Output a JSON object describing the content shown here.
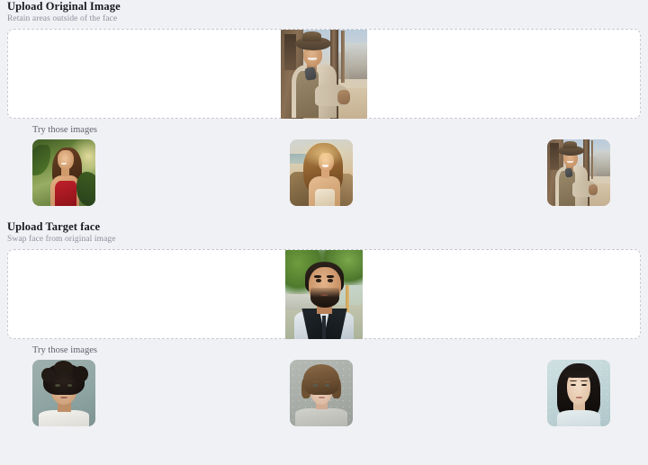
{
  "page": {
    "background_color": "#f0f1f5"
  },
  "sections": [
    {
      "id": "upload-original-image",
      "title": "Upload Original Image",
      "subtitle": "Retain areas outside of the face",
      "dropzone": {
        "border_color": "#c9cad1",
        "background_color": "#ffffff",
        "preview_alt": "cowboy-leaning-on-post-in-western-town"
      },
      "try_label": "Try those images",
      "thumbnails": [
        {
          "alt": "woman-in-red-dress-in-jungle",
          "selected": false
        },
        {
          "alt": "woman-with-long-hair-at-beach-sunset",
          "selected": false
        },
        {
          "alt": "cowboy-leaning-on-post-in-western-town",
          "selected": true
        }
      ]
    },
    {
      "id": "upload-target-face",
      "title": "Upload Target face",
      "subtitle": "Swap face from original image",
      "dropzone": {
        "border_color": "#c9cad1",
        "background_color": "#ffffff",
        "preview_alt": "bearded-man-in-white-jacket-outdoors"
      },
      "try_label": "Try those images",
      "thumbnails": [
        {
          "alt": "man-with-curly-dark-hair-portrait",
          "selected": false
        },
        {
          "alt": "young-woman-in-grey-sweater-portrait",
          "selected": false
        },
        {
          "alt": "asian-woman-with-dark-hair-portrait",
          "selected": false
        }
      ]
    }
  ]
}
